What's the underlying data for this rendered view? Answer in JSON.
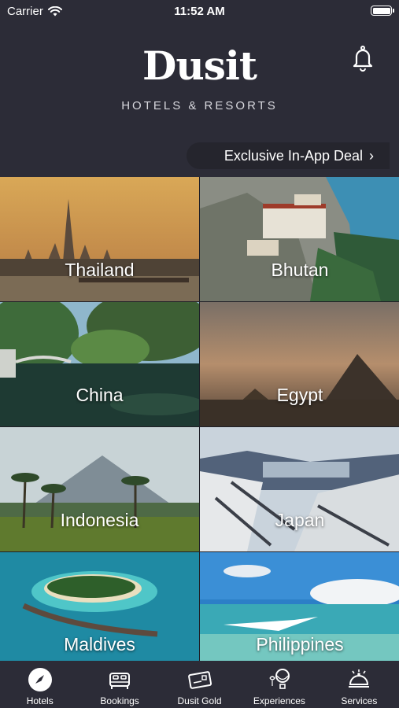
{
  "status": {
    "carrier": "Carrier",
    "time": "11:52 AM"
  },
  "brand": {
    "logo": "Dusit",
    "tagline": "HOTELS & RESORTS"
  },
  "deal": {
    "label": "Exclusive In-App Deal"
  },
  "destinations": [
    {
      "name": "Thailand"
    },
    {
      "name": "Bhutan"
    },
    {
      "name": "China"
    },
    {
      "name": "Egypt"
    },
    {
      "name": "Indonesia"
    },
    {
      "name": "Japan"
    },
    {
      "name": "Maldives"
    },
    {
      "name": "Philippines"
    }
  ],
  "tabs": [
    {
      "label": "Hotels",
      "icon": "compass-icon"
    },
    {
      "label": "Bookings",
      "icon": "bed-icon"
    },
    {
      "label": "Dusit Gold",
      "icon": "card-icon"
    },
    {
      "label": "Experiences",
      "icon": "balloon-icon"
    },
    {
      "label": "Services",
      "icon": "service-bell-icon"
    }
  ]
}
